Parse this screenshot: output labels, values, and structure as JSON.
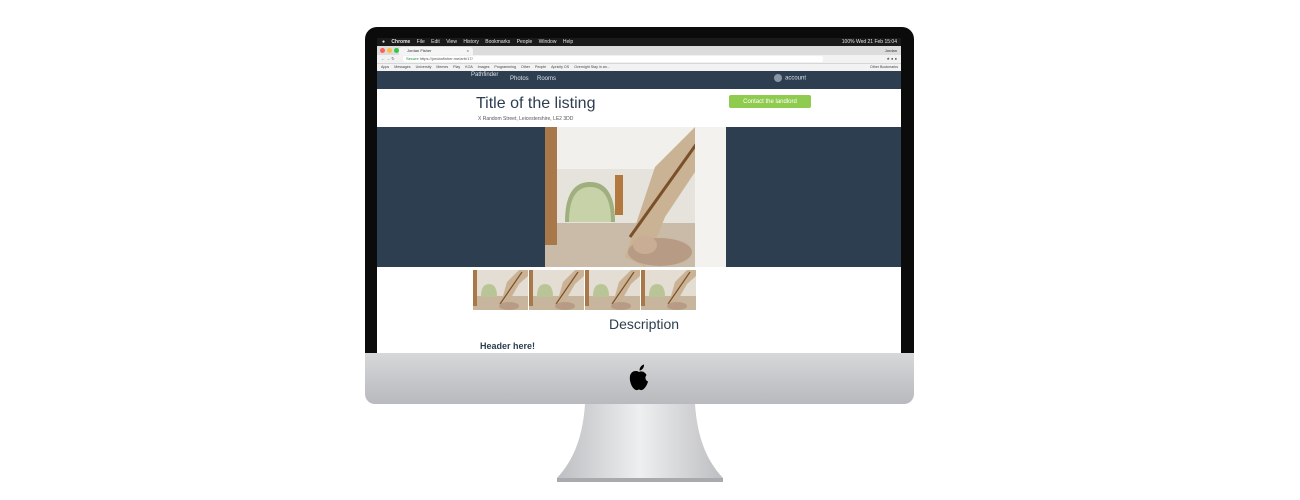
{
  "mac_menubar": {
    "items": [
      "Chrome",
      "File",
      "Edit",
      "View",
      "History",
      "Bookmarks",
      "People",
      "Window",
      "Help"
    ],
    "status": "100% Wed 21 Feb 15:04"
  },
  "browser": {
    "tab_title": "Jordan Fisher",
    "tab_close": "×",
    "profile": "Jordan",
    "secure_label": "Secure",
    "url": "https://jordanfisher.me/arb/17/",
    "bookmarks": [
      "Apps",
      "Messages",
      "University",
      "Memes",
      "Play",
      "KOA",
      "Images",
      "Programming",
      "Other",
      "People",
      "Apricity OS",
      "Overnight Stay in an..."
    ],
    "other_bookmarks": "Other Bookmarks"
  },
  "site": {
    "brand": "Pathfinder",
    "nav_photos": "Photos",
    "nav_rooms": "Rooms",
    "account": "account"
  },
  "listing": {
    "title": "Title of the listing",
    "address": "X Random Street, Leicestershire, LE2 3DD",
    "contact_button": "Contact the landlord"
  },
  "description": {
    "heading": "Description",
    "sub_heading": "Header here!"
  },
  "colors": {
    "nav_bg": "#2c3e50",
    "accent_green": "#8fcb4f",
    "heading_text": "#2c3e50"
  }
}
